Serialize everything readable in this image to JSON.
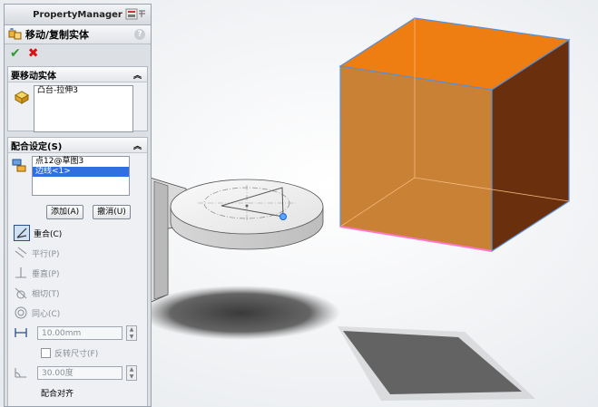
{
  "property_manager": {
    "title": "PropertyManager",
    "feature_name": "移动/复制实体",
    "help": "?"
  },
  "bodies_group": {
    "header": "要移动实体",
    "items": [
      "凸台-拉伸3"
    ]
  },
  "mate_group": {
    "header": "配合设定(S)",
    "selections": [
      "点12@草图3",
      "边线<1>"
    ],
    "add_label": "添加(A)",
    "undo_label": "撤消(U)",
    "mate_types": {
      "coincident": "重合(C)",
      "parallel": "平行(P)",
      "perpendicular": "垂直(P)",
      "tangent": "相切(T)",
      "concentric": "同心(C)"
    },
    "distance_value": "10.00mm",
    "flip_label": "反转尺寸(F)",
    "angle_value": "30.00度",
    "alignment_label": "配合对齐"
  },
  "colors": {
    "cube_face_front": "#c77b2c",
    "cube_face_top": "#ee7d12",
    "cube_face_side": "#6a2f0c",
    "cube_edge": "#5b8fd0",
    "selection_blue": "#2f6fe0"
  }
}
